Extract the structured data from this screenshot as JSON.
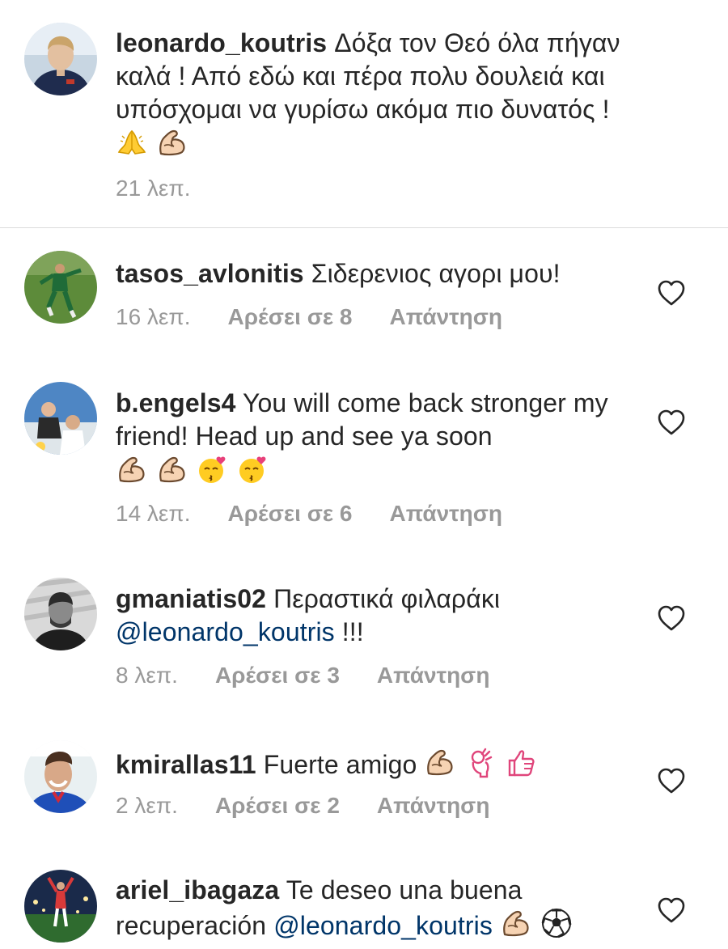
{
  "caption": {
    "username": "leonardo_koutris",
    "text": "Δόξα τον Θεό όλα πήγαν καλά ! Από εδώ και πέρα πολυ δουλειά και υπόσχομαι να γυρίσω ακόμα πιο δυνατός !",
    "emojis": [
      "folded-hands-emoji",
      "flexed-biceps-emoji"
    ],
    "time": "21 λεπ."
  },
  "comments": [
    {
      "username": "tasos_avlonitis",
      "text": "Σιδερενιος αγορι μου!",
      "time": "16 λεπ.",
      "likes": "Αρέσει σε 8",
      "reply": "Απάντηση"
    },
    {
      "username": "b.engels4",
      "text": "You will come back stronger my friend! Head up and see ya soon",
      "emojis": [
        "flexed-biceps-emoji",
        "flexed-biceps-emoji",
        "kissing-heart-emoji",
        "kissing-heart-emoji"
      ],
      "time": "14 λεπ.",
      "likes": "Αρέσει σε 6",
      "reply": "Απάντηση"
    },
    {
      "username": "gmaniatis02",
      "text": "Περαστικά φιλαράκι",
      "mention": "@leonardo_koutris",
      "suffix": " !!!",
      "time": "8 λεπ.",
      "likes": "Αρέσει σε 3",
      "reply": "Απάντηση"
    },
    {
      "username": "kmirallas11",
      "text": "Fuerte amigo",
      "emojis": [
        "flexed-biceps-emoji",
        "ok-hand-emoji",
        "thumbs-up-emoji"
      ],
      "time": "2 λεπ.",
      "likes": "Αρέσει σε 2",
      "reply": "Απάντηση"
    },
    {
      "username": "ariel_ibagaza",
      "text": "Te deseo una buena recuperación",
      "mention": "@leonardo_koutris",
      "emojis": [
        "flexed-biceps-emoji",
        "soccer-ball-emoji"
      ]
    }
  ],
  "colors": {
    "text": "#262626",
    "meta": "#999999",
    "mention": "#003569",
    "divider": "#dbdbdb",
    "heart_outline": "#262626"
  }
}
